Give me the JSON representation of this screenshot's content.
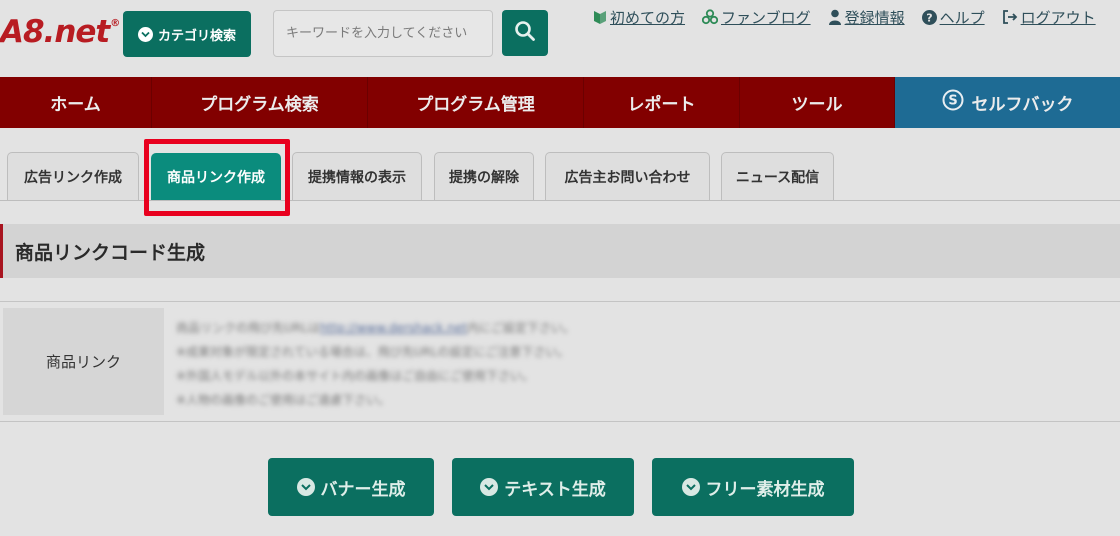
{
  "header": {
    "logo": "A8.net",
    "logo_mark": "®",
    "category_button": "カテゴリ検索",
    "search_placeholder": "キーワードを入力してください",
    "links": [
      {
        "icon": "beginner-leaf-icon",
        "label": "初めての方"
      },
      {
        "icon": "fan-blog-icon",
        "label": "ファンブログ"
      },
      {
        "icon": "user-icon",
        "label": "登録情報"
      },
      {
        "icon": "help-icon",
        "label": "ヘルプ"
      },
      {
        "icon": "logout-icon",
        "label": "ログアウト"
      }
    ]
  },
  "nav": {
    "items": [
      "ホーム",
      "プログラム検索",
      "プログラム管理",
      "レポート",
      "ツール"
    ],
    "selfback": "セルフバック"
  },
  "tabs": {
    "items": [
      "広告リンク作成",
      "商品リンク作成",
      "提携情報の表示",
      "提携の解除",
      "広告主お問い合わせ",
      "ニュース配信"
    ],
    "active": "商品リンク作成"
  },
  "section": {
    "title": "商品リンクコード生成",
    "row_label": "商品リンク",
    "desc": {
      "line1_before": "商品リンクの飛び先URLは",
      "line1_link": "http://www.dershack.net",
      "line1_after": "内にご設定下さい。",
      "line2": "※成果対象が限定されている場合は、飛び先URLの設定にご注意下さい。",
      "line3": "※外国人モデル以外の本サイト内の画像はご自由にご使用下さい。",
      "line4": "※人物の画像のご使用はご遠慮下さい。"
    }
  },
  "actions": {
    "banner": "バナー生成",
    "text": "テキスト生成",
    "free": "フリー素材生成"
  },
  "colors": {
    "brand_red": "#b81c22",
    "nav_red": "#820000",
    "green": "#0b6f60",
    "active_tab": "#0b8c7d",
    "selfback_blue": "#1e6b94",
    "highlight": "#e8001e"
  }
}
